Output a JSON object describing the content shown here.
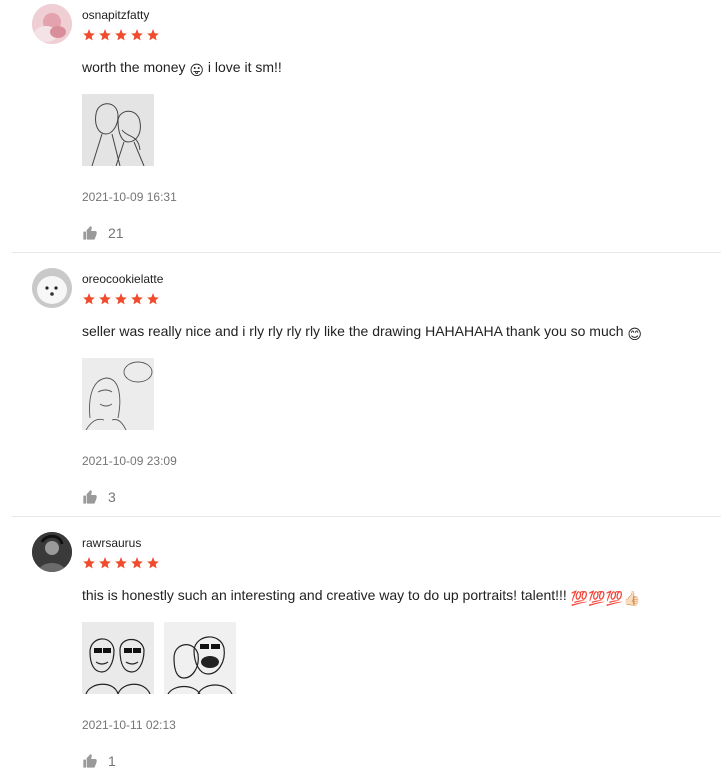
{
  "colors": {
    "star": "#ee4d2d",
    "muted": "#757575",
    "divider": "#e8e8e8"
  },
  "rating_stars": 5,
  "reviews": [
    {
      "username": "osnapitzfatty",
      "rating": 5,
      "comment": "worth the money",
      "comment_after": "i love it sm!!",
      "emoji": "😛",
      "date": "2021-10-09 16:31",
      "likes": "21",
      "icons": {
        "avatar": "avatar-pink-hand",
        "like": "thumbs-up-icon"
      }
    },
    {
      "username": "oreocookielatte",
      "rating": 5,
      "comment": "seller was really nice and i rly rly rly rly like the drawing HAHAHAHA thank you so much",
      "emoji": "😊",
      "date": "2021-10-09 23:09",
      "likes": "3",
      "icons": {
        "avatar": "avatar-white-dog",
        "like": "thumbs-up-icon"
      }
    },
    {
      "username": "rawrsaurus",
      "rating": 5,
      "comment": "this is honestly such an interesting and creative way to do up portraits! talent!!!",
      "emoji": "💯💯💯👍🏻",
      "date": "2021-10-11 02:13",
      "likes": "1",
      "icons": {
        "avatar": "avatar-dark-person",
        "like": "thumbs-up-icon"
      }
    }
  ]
}
